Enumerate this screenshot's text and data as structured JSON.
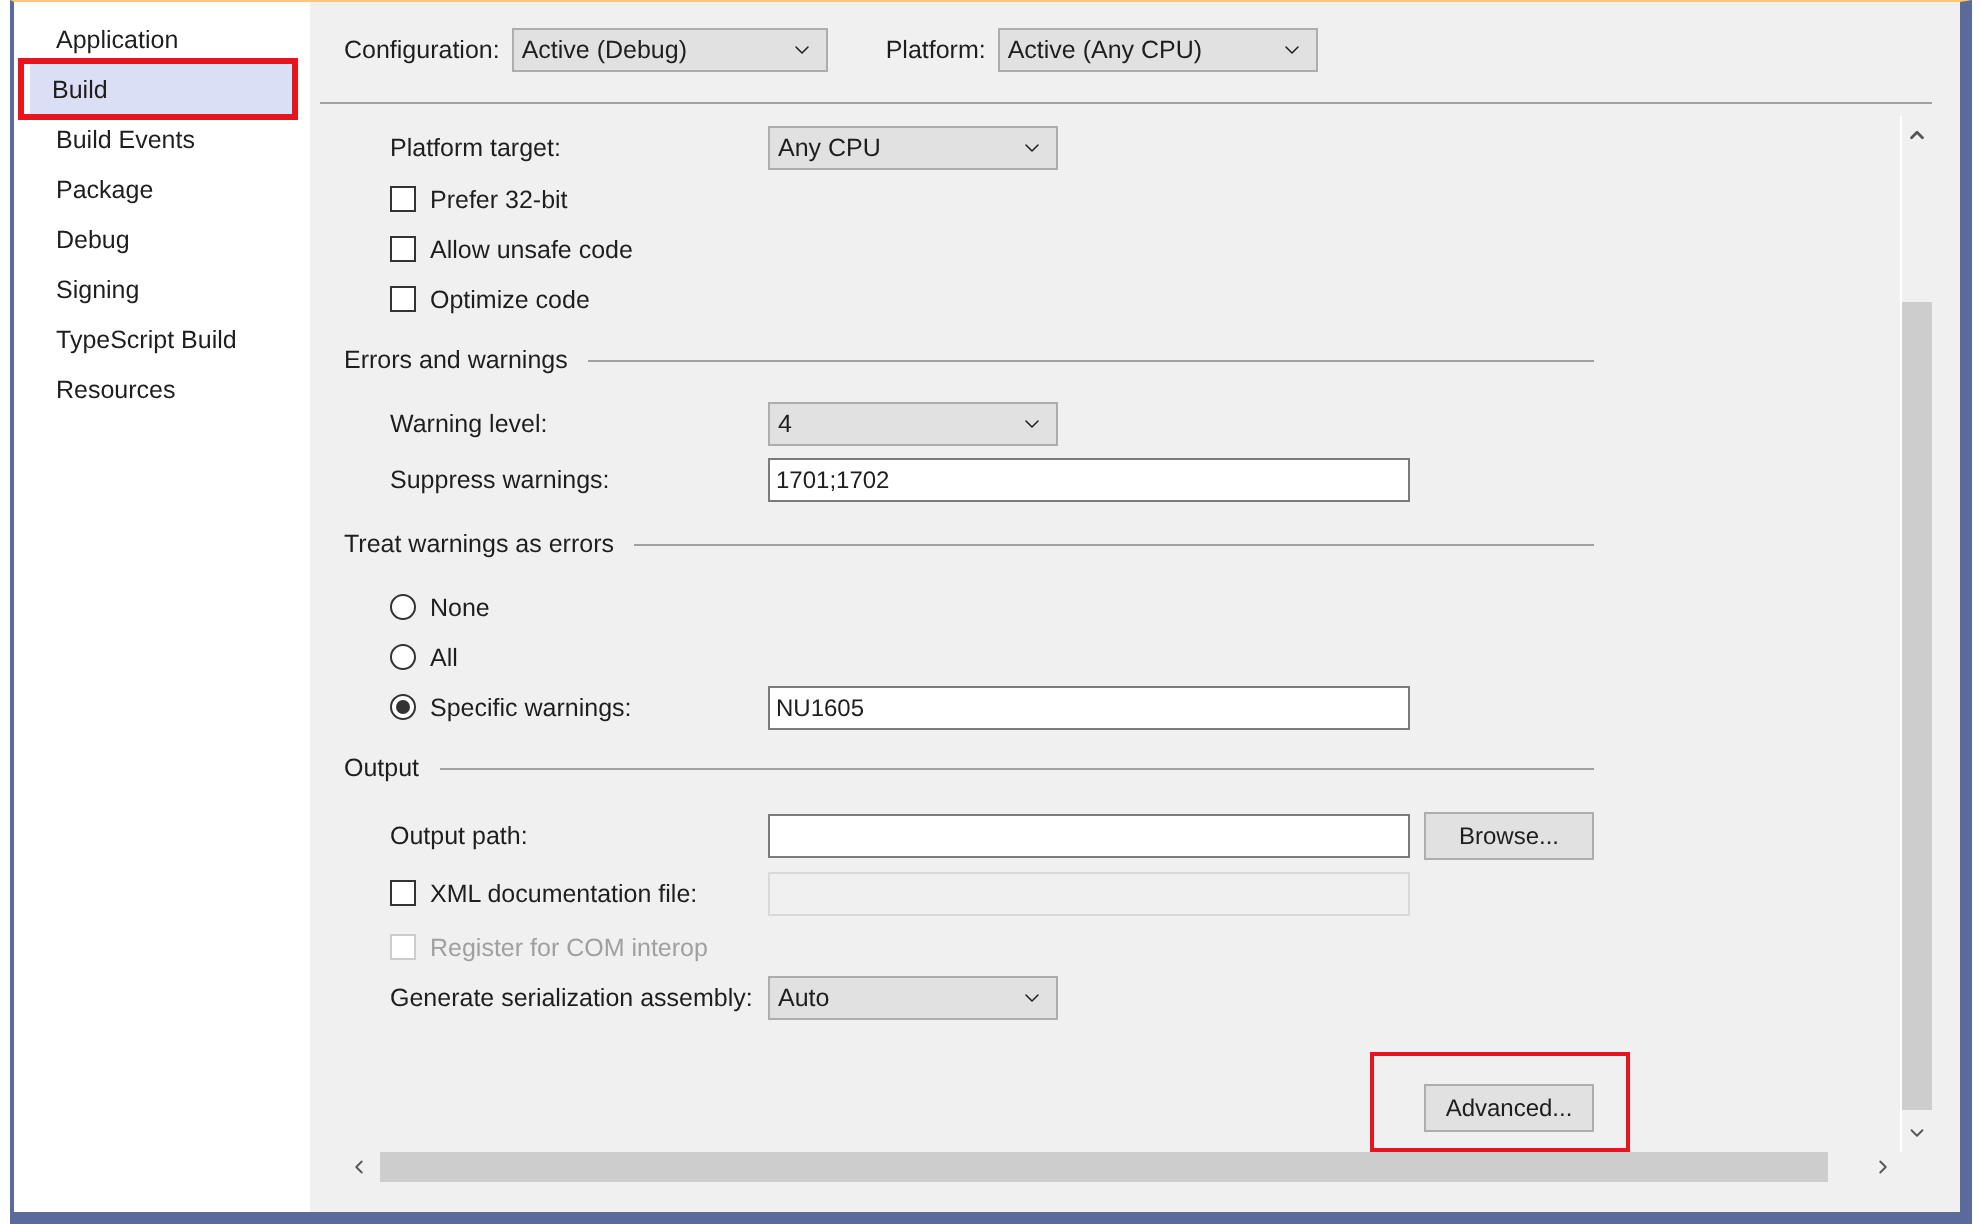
{
  "sidebar": {
    "items": [
      {
        "label": "Application",
        "selected": false,
        "highlighted": false
      },
      {
        "label": "Build",
        "selected": true,
        "highlighted": true
      },
      {
        "label": "Build Events",
        "selected": false,
        "highlighted": false
      },
      {
        "label": "Package",
        "selected": false,
        "highlighted": false
      },
      {
        "label": "Debug",
        "selected": false,
        "highlighted": false
      },
      {
        "label": "Signing",
        "selected": false,
        "highlighted": false
      },
      {
        "label": "TypeScript Build",
        "selected": false,
        "highlighted": false
      },
      {
        "label": "Resources",
        "selected": false,
        "highlighted": false
      }
    ]
  },
  "toolbar": {
    "configuration": {
      "label": "Configuration:",
      "value": "Active (Debug)"
    },
    "platform": {
      "label": "Platform:",
      "value": "Active (Any CPU)"
    }
  },
  "sections": [
    {
      "rows": [
        {
          "kind": "select",
          "label": "Platform target:",
          "value": "Any CPU"
        },
        {
          "kind": "checkbox",
          "label": "Prefer 32-bit",
          "checked": false,
          "disabled": false
        },
        {
          "kind": "checkbox",
          "label": "Allow unsafe code",
          "checked": false,
          "disabled": false
        },
        {
          "kind": "checkbox",
          "label": "Optimize code",
          "checked": false,
          "disabled": false
        }
      ]
    },
    {
      "title": "Errors and warnings",
      "rows": [
        {
          "kind": "select",
          "label": "Warning level:",
          "value": "4"
        },
        {
          "kind": "text",
          "label": "Suppress warnings:",
          "value": "1701;1702",
          "disabled": false
        }
      ]
    },
    {
      "title": "Treat warnings as errors",
      "rows": [
        {
          "kind": "radio",
          "label": "None",
          "selected": false
        },
        {
          "kind": "radio",
          "label": "All",
          "selected": false
        },
        {
          "kind": "radio",
          "label": "Specific warnings:",
          "selected": true,
          "field": {
            "value": "NU1605",
            "disabled": false
          }
        }
      ]
    },
    {
      "title": "Output",
      "rows": [
        {
          "kind": "text",
          "label": "Output path:",
          "disabled": false,
          "button": "Browse..."
        },
        {
          "kind": "checkbox",
          "label": "XML documentation file:",
          "checked": false,
          "disabled": false,
          "field": {
            "disabled": true
          }
        },
        {
          "kind": "checkbox",
          "label": "Register for COM interop",
          "checked": false,
          "disabled": true
        },
        {
          "kind": "select",
          "label": "Generate serialization assembly:",
          "value": "Auto"
        }
      ]
    }
  ],
  "advanced_button": {
    "label": "Advanced...",
    "highlighted": true
  }
}
